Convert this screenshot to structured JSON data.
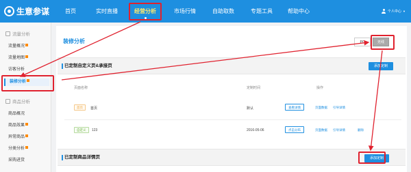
{
  "header": {
    "logo_text": "生意参谋",
    "nav": [
      "首页",
      "实时直播",
      "经营分析",
      "市场行情",
      "自助取数",
      "专题工具",
      "帮助中心"
    ],
    "user_label": "个人中心"
  },
  "sidebar": {
    "group1_label": "流量分析",
    "group1_items": [
      "流量概况",
      "流量地图",
      "访客分析",
      "装修分析"
    ],
    "group2_label": "商品分析",
    "group2_items": [
      "商品概况",
      "商品效果",
      "异常商品",
      "分类分析",
      "采购进货"
    ]
  },
  "main": {
    "title": "装修分析",
    "toggle_pc": "PC",
    "toggle_wireless": "无线",
    "section1_title": "已定制自定义页&承接页",
    "add_button": "添加定制",
    "columns": [
      "页面名称",
      "定制时间",
      "操作"
    ],
    "rows": [
      {
        "tag": "首页",
        "name": "首页",
        "time": "默认",
        "primary_action": "查看详情",
        "link1": "页面数据",
        "link2": "引导详情",
        "link3": ""
      },
      {
        "tag": "自定义",
        "name": "123",
        "time": "2016-05-06",
        "primary_action": "点击分布",
        "link1": "页面数据",
        "link2": "引导详情",
        "link3": "删除"
      }
    ],
    "section2_title": "已定制商品详情页",
    "add_button2": "添加定制"
  },
  "colors": {
    "primary": "#1e8fe0",
    "annotation": "#e0212e",
    "active_nav": "#ffe86b"
  }
}
